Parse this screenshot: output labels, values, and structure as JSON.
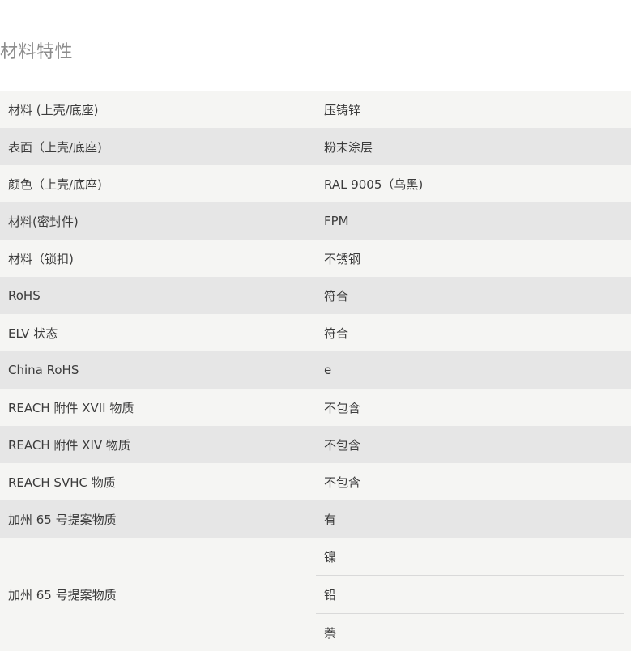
{
  "section": {
    "title": "材料特性"
  },
  "rows": [
    {
      "label": "材料 (上壳/底座)",
      "value": "压铸锌"
    },
    {
      "label": "表面（上壳/底座)",
      "value": "粉末涂层"
    },
    {
      "label": "颜色（上壳/底座)",
      "value": "RAL 9005（乌黑)"
    },
    {
      "label": "材料(密封件)",
      "value": "FPM"
    },
    {
      "label": "材料（锁扣)",
      "value": "不锈钢"
    },
    {
      "label": "RoHS",
      "value": "符合"
    },
    {
      "label": "ELV 状态",
      "value": "符合"
    },
    {
      "label": "China RoHS",
      "value": "e"
    },
    {
      "label": "REACH 附件 XVII 物质",
      "value": "不包含"
    },
    {
      "label": "REACH 附件 XIV 物质",
      "value": "不包含"
    },
    {
      "label": "REACH SVHC 物质",
      "value": "不包含"
    },
    {
      "label": "加州 65 号提案物质",
      "value": "有"
    }
  ],
  "multi_row": {
    "label": "加州 65 号提案物质",
    "values": [
      "镍",
      "铅",
      "萘"
    ]
  }
}
